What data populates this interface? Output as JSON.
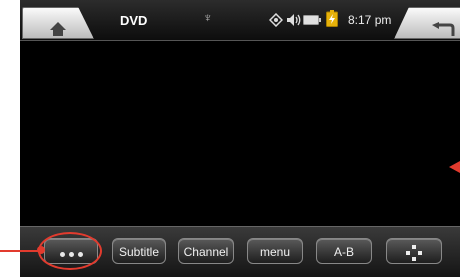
{
  "status_bar": {
    "title": "DVD",
    "time": "8:17 pm",
    "icons": [
      "home-icon",
      "usb-icon",
      "brightness-icon",
      "volume-icon",
      "battery-icon",
      "charging-icon",
      "back-icon"
    ],
    "usb_glyph": "♆"
  },
  "toolbar": {
    "buttons": [
      {
        "name": "more-options",
        "label": "",
        "icon": "ellipsis-icon"
      },
      {
        "name": "subtitle",
        "label": "Subtitle"
      },
      {
        "name": "channel",
        "label": "Channel"
      },
      {
        "name": "menu",
        "label": "menu"
      },
      {
        "name": "a-b",
        "label": "A-B"
      },
      {
        "name": "dpad",
        "label": "",
        "icon": "dpad-icon"
      }
    ]
  },
  "colors": {
    "annotation": "#e23b2e",
    "background": "#000000"
  }
}
